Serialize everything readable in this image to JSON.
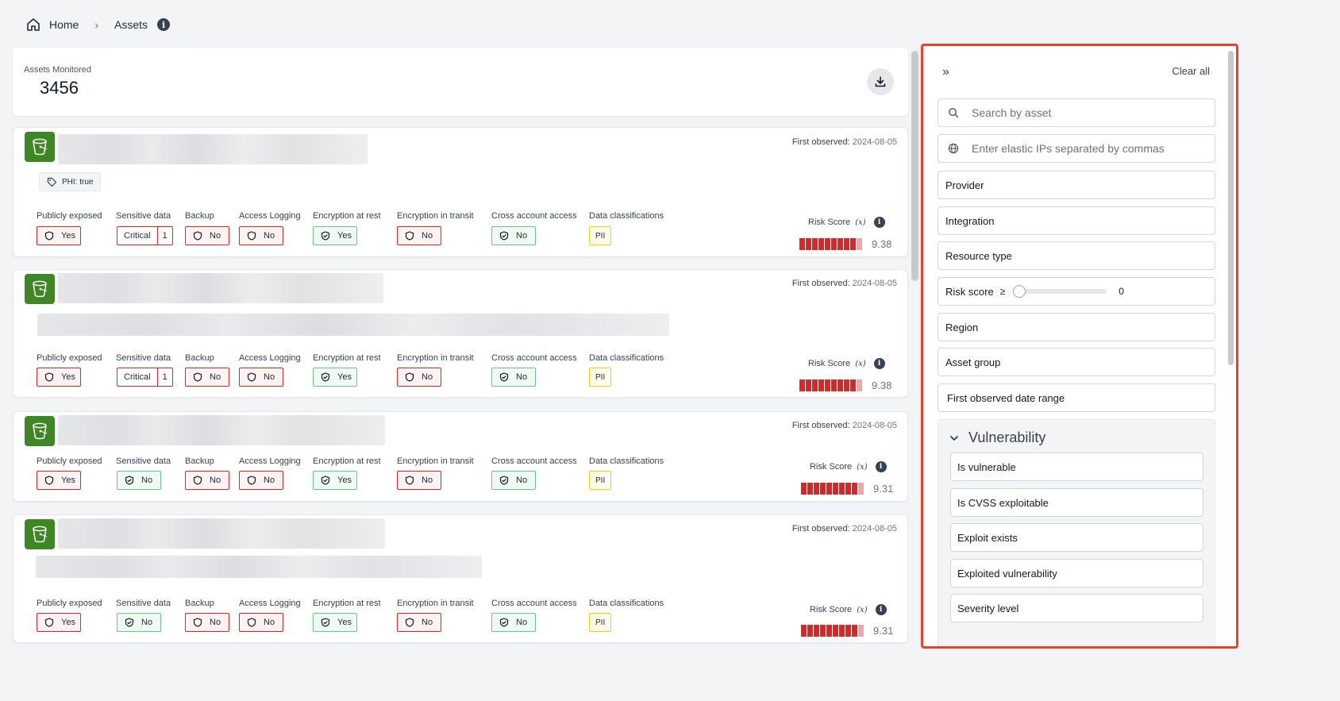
{
  "breadcrumb": {
    "home": "Home",
    "current": "Assets",
    "info": "i"
  },
  "summary": {
    "label": "Assets Monitored",
    "value": "3456"
  },
  "attr_labels": [
    "Publicly exposed",
    "Sensitive data",
    "Backup",
    "Access Logging",
    "Encryption at rest",
    "Encryption in transit",
    "Cross account access",
    "Data classifications"
  ],
  "first_observed_label": "First observed:",
  "risk_label": "Risk Score",
  "risk_x": "(x)",
  "assets": [
    {
      "first_observed": "2024-08-05",
      "tag": "PHI: true",
      "publicly_exposed": "Yes",
      "sensitive_label": "Critical",
      "sensitive_count": "1",
      "backup": "No",
      "access_logging": "No",
      "enc_rest": "Yes",
      "enc_transit": "No",
      "cross_account": "No",
      "classification": "PII",
      "risk_score": 9.38,
      "risk_text": "9.38"
    },
    {
      "first_observed": "2024-08-05",
      "publicly_exposed": "Yes",
      "sensitive_label": "Critical",
      "sensitive_count": "1",
      "backup": "No",
      "access_logging": "No",
      "enc_rest": "Yes",
      "enc_transit": "No",
      "cross_account": "No",
      "classification": "PII",
      "risk_score": 9.38,
      "risk_text": "9.38"
    },
    {
      "first_observed": "2024-08-05",
      "publicly_exposed": "Yes",
      "sensitive_data": "No",
      "backup": "No",
      "access_logging": "No",
      "enc_rest": "Yes",
      "enc_transit": "No",
      "cross_account": "No",
      "classification": "PII",
      "risk_score": 9.31,
      "risk_text": "9.31"
    },
    {
      "first_observed": "2024-08-05",
      "publicly_exposed": "Yes",
      "sensitive_data": "No",
      "backup": "No",
      "access_logging": "No",
      "enc_rest": "Yes",
      "enc_transit": "No",
      "cross_account": "No",
      "classification": "PII",
      "risk_score": 9.31,
      "risk_text": "9.31"
    }
  ],
  "filters": {
    "collapse": "»",
    "clear_all": "Clear all",
    "search_placeholder": "Search by asset",
    "ip_placeholder": "Enter elastic IPs separated by commas",
    "provider": "Provider",
    "integration": "Integration",
    "resource_type": "Resource type",
    "risk_score": "Risk score",
    "risk_op": "≥",
    "risk_value": "0",
    "region": "Region",
    "asset_group": "Asset group",
    "date_range": "First observed date range",
    "vulnerability": {
      "title": "Vulnerability",
      "items": [
        "Is vulnerable",
        "Is CVSS exploitable",
        "Exploit exists",
        "Exploited vulnerability",
        "Severity level"
      ]
    }
  },
  "colors": {
    "bad": "#dc2626",
    "good": "#6ac48a",
    "pii": "#facc15",
    "highlight": "#e8412c",
    "bucket": "#3f8624"
  }
}
